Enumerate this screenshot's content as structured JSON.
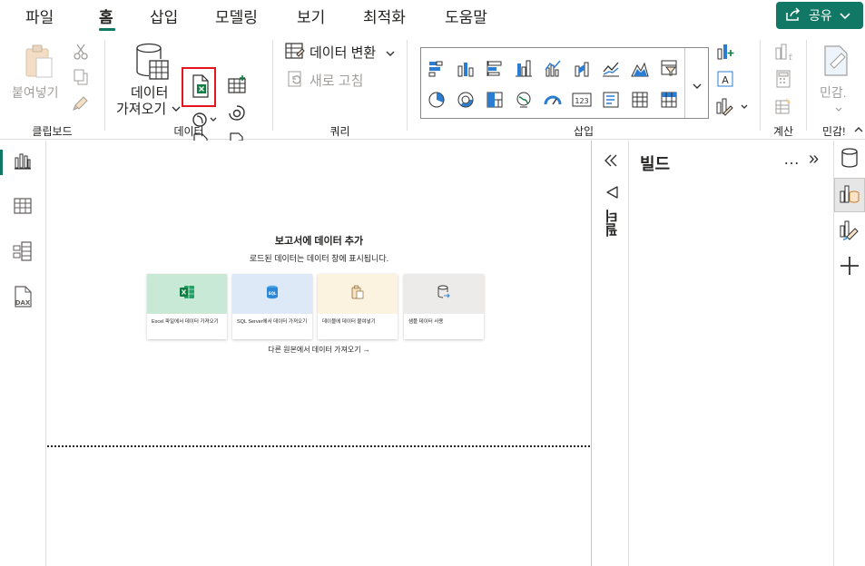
{
  "menu": {
    "tabs": [
      "파일",
      "홈",
      "삽입",
      "모델링",
      "보기",
      "최적화",
      "도움말"
    ],
    "active_tab": "홈",
    "share_label": "공유"
  },
  "ribbon": {
    "clipboard": {
      "paste_label": "붙여넣기",
      "group_label": "클립보드"
    },
    "data": {
      "get_data_line1": "데이터",
      "get_data_line2": "가져오기",
      "group_label": "데이터"
    },
    "queries": {
      "transform_label": "데이터 변환",
      "refresh_label": "새로 고침",
      "group_label": "쿼리"
    },
    "insert": {
      "group_label": "삽입"
    },
    "calculations": {
      "group_label": "계산"
    },
    "sensitivity": {
      "button_label": "민감.",
      "group_label": "민감!"
    }
  },
  "canvas": {
    "title": "보고서에 데이터 추가",
    "subtitle": "로드된 데이터는 데이터 창에 표시됩니다.",
    "cards": [
      {
        "label": "Excel 파일에서 데이터 가져오기",
        "bg": "#c7e9d5"
      },
      {
        "label": "SQL Server에서 데이터 가져오기",
        "bg": "#dde9f6"
      },
      {
        "label": "데이블에 데이터 붙여넣기",
        "bg": "#fbf3e0"
      },
      {
        "label": "샘플 데이터 사용",
        "bg": "#ecebea"
      }
    ],
    "other_sources": "다른 원본에서 데이터 가져오기 →"
  },
  "filter_pane": {
    "label": "필터"
  },
  "build_pane": {
    "title": "빌드",
    "more": "…",
    "expand": "»"
  },
  "colors": {
    "accent": "#117865",
    "highlight": "#e3161d",
    "excel_green": "#107c41"
  }
}
